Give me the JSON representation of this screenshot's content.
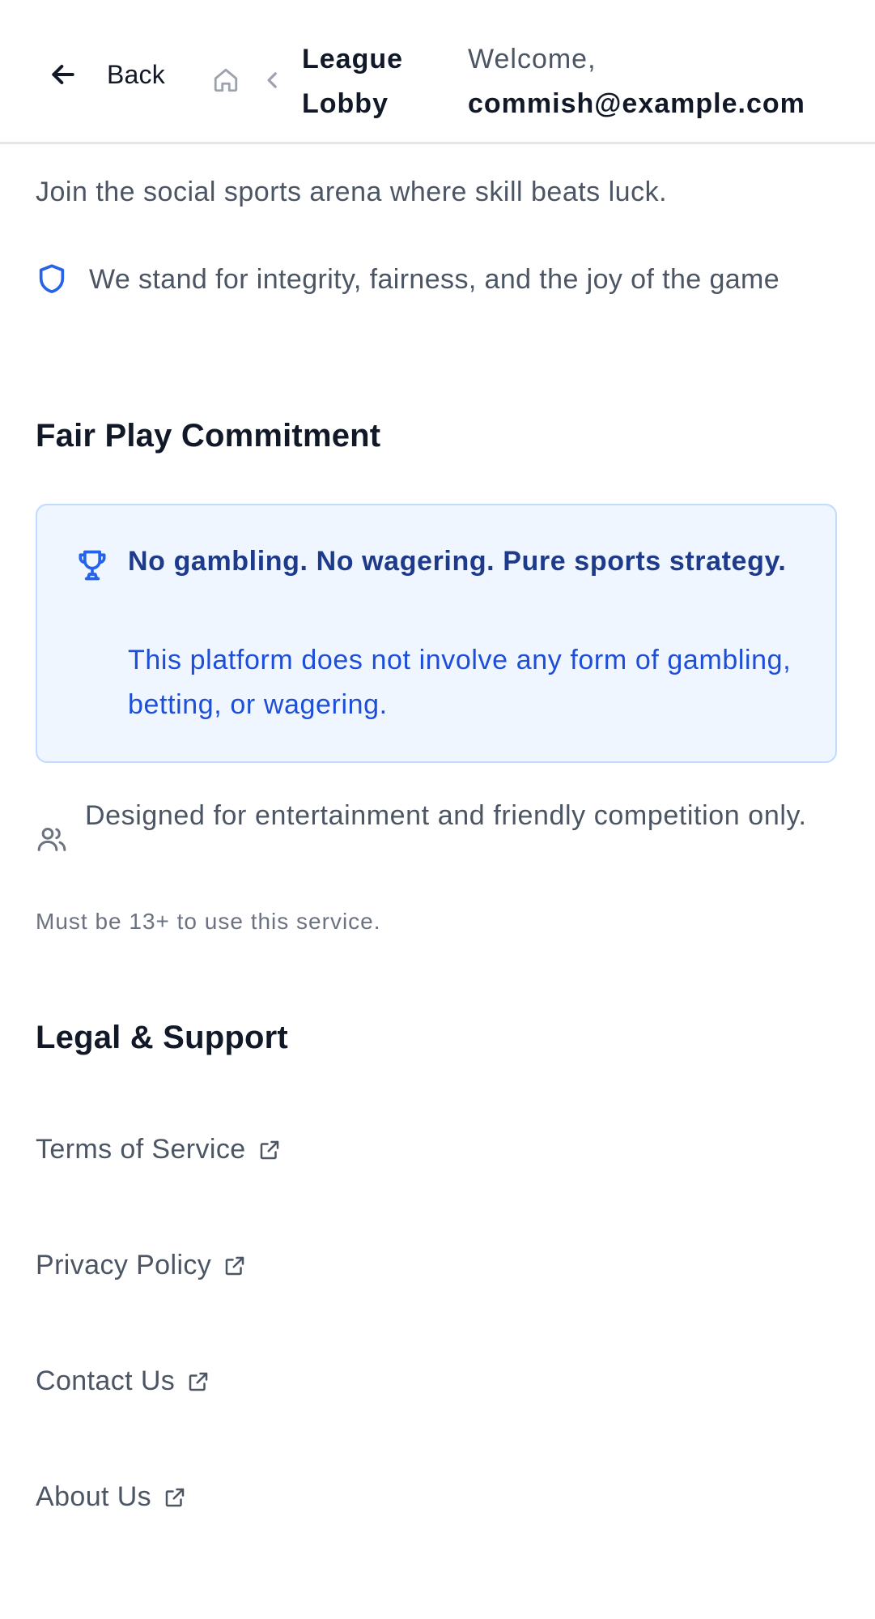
{
  "header": {
    "back_label": "Back",
    "breadcrumb_current": "League Lobby",
    "welcome_prefix": "Welcome,",
    "user_email": "commish@example.com"
  },
  "intro": {
    "tagline": "Join the social sports arena where skill beats luck.",
    "integrity": "We stand for integrity, fairness, and the joy of the game"
  },
  "fair_play": {
    "title": "Fair Play Commitment",
    "notice_title": "No gambling. No wagering. Pure sports strategy.",
    "notice_body": "This platform does not involve any form of gambling, betting, or wagering.",
    "designed": "Designed for entertainment and friendly competition only.",
    "age_notice": "Must be 13+ to use this service."
  },
  "legal": {
    "title": "Legal & Support",
    "links": [
      {
        "label": "Terms of Service"
      },
      {
        "label": "Privacy Policy"
      },
      {
        "label": "Contact Us"
      },
      {
        "label": "About Us"
      }
    ]
  },
  "icons": {
    "back": "arrow-left-icon",
    "home": "home-icon",
    "separator": "chevron-left-icon",
    "integrity": "shield-icon",
    "notice": "trophy-icon",
    "designed": "users-icon",
    "external": "external-link-icon"
  },
  "colors": {
    "accent": "#2563eb",
    "notice_bg": "#eff6ff",
    "notice_border": "#bfdbfe",
    "notice_title": "#1e3a8a",
    "notice_body": "#1d4ed8",
    "text_muted": "#4b5563"
  }
}
